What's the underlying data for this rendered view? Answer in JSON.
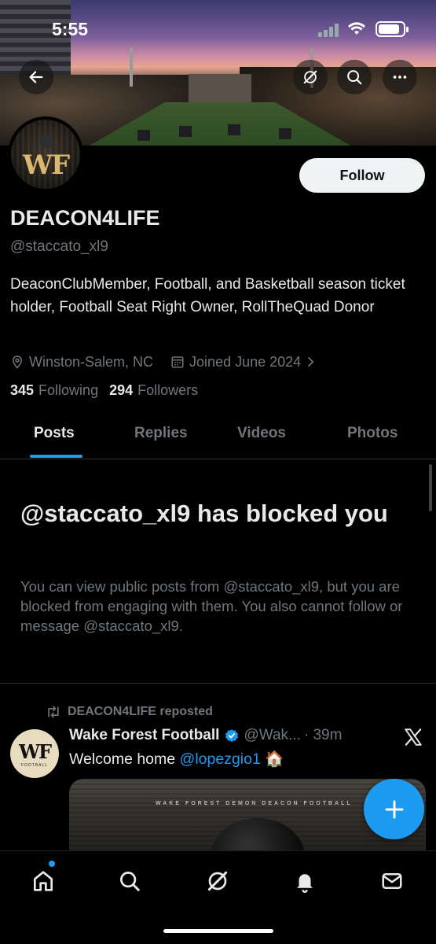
{
  "status_bar": {
    "time": "5:55",
    "battery_level": 0.85
  },
  "header": {
    "back_icon": "arrow-left-icon",
    "grok_icon": "grok-icon",
    "search_icon": "search-icon",
    "more_icon": "more-horizontal-icon"
  },
  "profile": {
    "avatar_text": "WF",
    "follow_label": "Follow",
    "display_name": "DEACON4LIFE",
    "handle": "@staccato_xl9",
    "bio": "DeaconClubMember, Football, and Basketball season ticket holder, Football Seat Right Owner, RollTheQuad Donor",
    "location": "Winston-Salem, NC",
    "joined": "Joined June 2024",
    "following_count": "345",
    "following_label": "Following",
    "followers_count": "294",
    "followers_label": "Followers"
  },
  "tabs": [
    {
      "label": "Posts",
      "active": true
    },
    {
      "label": "Replies",
      "active": false
    },
    {
      "label": "Videos",
      "active": false
    },
    {
      "label": "Photos",
      "active": false
    }
  ],
  "blocked": {
    "title": "@staccato_xl9 has blocked you",
    "message": "You can view public posts from @staccato_xl9, but you are blocked from engaging with them. You also cannot follow or message @staccato_xl9."
  },
  "tweet": {
    "repost_label": "DEACON4LIFE reposted",
    "author_name": "Wake Forest Football",
    "author_handle": "@Wak...",
    "time": "· 39m",
    "text_prefix": "Welcome home ",
    "mention": "@lopezgio1",
    "emoji": "🏠",
    "avatar_text": "WF",
    "avatar_subtext": "FOOTBALL",
    "media_caption": "WAKE FOREST DEMON DEACON FOOTBALL"
  },
  "colors": {
    "accent": "#1d9bf0",
    "background": "#000000",
    "text_primary": "#e7e9ea",
    "text_secondary": "#71767b"
  },
  "nav": {
    "items": [
      "home-icon",
      "search-icon",
      "grok-icon",
      "notifications-icon",
      "messages-icon"
    ]
  }
}
